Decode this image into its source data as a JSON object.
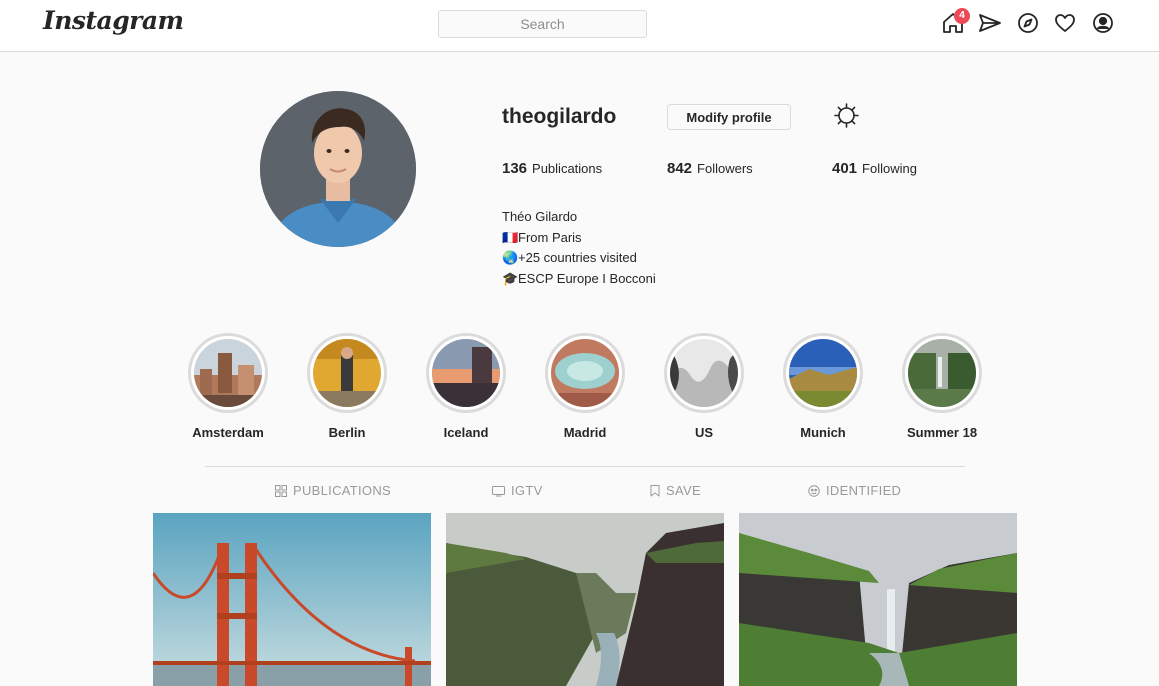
{
  "header": {
    "logo": "Instagram",
    "search_placeholder": "Search",
    "notification_count": "4",
    "icons": [
      "home-icon",
      "direct-icon",
      "explore-icon",
      "activity-heart-icon",
      "profile-icon"
    ]
  },
  "profile": {
    "username": "theogilardo",
    "modify_label": "Modify profile",
    "stats": {
      "publications_count": "136",
      "publications_label": "Publications",
      "followers_count": "842",
      "followers_label": "Followers",
      "following_count": "401",
      "following_label": "Following"
    },
    "bio": {
      "name": "Théo Gilardo",
      "line1_emoji": "🇫🇷",
      "line1": "From Paris",
      "line2_emoji": "🌏",
      "line2": "+25 countries visited",
      "line3_emoji": "🎓",
      "line3": "ESCP Europe I Bocconi"
    }
  },
  "highlights": [
    {
      "label": "Amsterdam"
    },
    {
      "label": "Berlin"
    },
    {
      "label": "Iceland"
    },
    {
      "label": "Madrid"
    },
    {
      "label": "US"
    },
    {
      "label": "Munich"
    },
    {
      "label": "Summer 18"
    }
  ],
  "tabs": [
    {
      "label": "PUBLICATIONS",
      "icon": "grid-icon"
    },
    {
      "label": "IGTV",
      "icon": "tv-icon"
    },
    {
      "label": "SAVE",
      "icon": "bookmark-icon"
    },
    {
      "label": "IDENTIFIED",
      "icon": "tagged-face-icon"
    }
  ],
  "colors": {
    "badge": "#ed4956",
    "border": "#dbdbdb",
    "background": "#fafafa",
    "text": "#262626",
    "tab_text": "#999999"
  }
}
